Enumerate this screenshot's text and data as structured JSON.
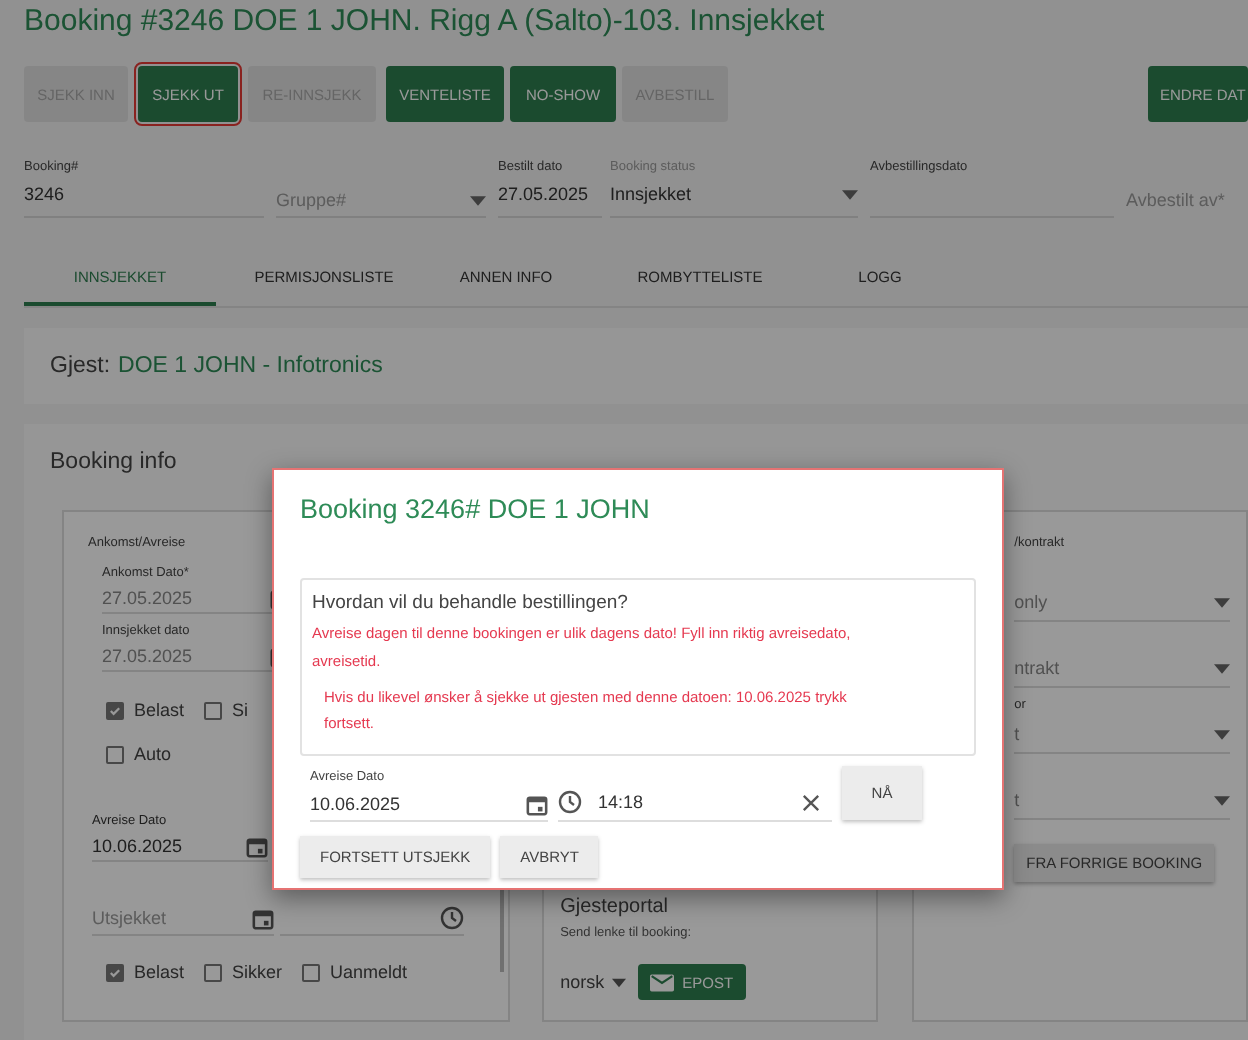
{
  "title": "Booking #3246 DOE 1 JOHN. Rigg A (Salto)-103. Innsjekket",
  "actions": [
    {
      "label": "SJEKK INN",
      "disabled": true,
      "focused": false
    },
    {
      "label": "SJEKK UT",
      "disabled": false,
      "focused": true
    },
    {
      "label": "RE-INNSJEKK",
      "disabled": true,
      "focused": false
    },
    {
      "label": "VENTELISTE",
      "disabled": false,
      "focused": false
    },
    {
      "label": "NO-SHOW",
      "disabled": false,
      "focused": false
    },
    {
      "label": "AVBESTILL",
      "disabled": true,
      "focused": false
    }
  ],
  "end_action": {
    "label": "ENDRE DAT"
  },
  "fields": [
    {
      "kind": "text",
      "label": "Booking#",
      "value": "3246"
    },
    {
      "kind": "select",
      "placeholder": "Gruppe#"
    },
    {
      "kind": "text",
      "label": "Bestilt dato",
      "value": "27.05.2025"
    },
    {
      "kind": "select",
      "label": "Booking status",
      "value": "Innsjekket"
    },
    {
      "kind": "text",
      "label": "Avbestillingsdato"
    },
    {
      "kind": "text",
      "placeholder": "Avbestilt av*"
    }
  ],
  "tabs": [
    {
      "label": "INNSJEKKET",
      "selected": true
    },
    {
      "label": "PERMISJONSLISTE",
      "selected": false
    },
    {
      "label": "ANNEN INFO",
      "selected": false
    },
    {
      "label": "ROMBYTTELISTE",
      "selected": false
    },
    {
      "label": "LOGG",
      "selected": false
    }
  ],
  "guest": {
    "label": "Gjest:",
    "name": "DOE 1 JOHN - Infotronics"
  },
  "booking_info": {
    "title": "Booking info",
    "arrival": {
      "heading": "Ankomst/Avreise",
      "dates": [
        {
          "label": "Ankomst Dato*",
          "value": "27.05.2025"
        },
        {
          "label": "Innsjekket dato",
          "value": "27.05.2025"
        }
      ],
      "checks": [
        {
          "label": "Belast",
          "checked": true
        },
        {
          "label": "Si",
          "checked": false
        }
      ],
      "checks_b": [
        {
          "label": "Auto",
          "checked": false
        }
      ],
      "departure": {
        "label": "Avreise Dato",
        "value": "10.06.2025"
      },
      "checkout": {
        "placeholder": "Utsjekket"
      },
      "checks_c": [
        {
          "label": "Belast",
          "checked": true
        },
        {
          "label": "Sikker",
          "checked": false
        },
        {
          "label": "Uanmeldt",
          "checked": false
        }
      ]
    },
    "portal": {
      "title": "Gjesteportal",
      "hint": "Send lenke til booking:",
      "language": "norsk",
      "button": "EPOST"
    },
    "contract": {
      "heading": "/kontrakt",
      "selects": [
        {
          "value": "only"
        },
        {
          "value": "ntrakt"
        },
        {
          "label": "or",
          "value": "t"
        },
        {
          "value": "t"
        }
      ],
      "button": "FRA FORRIGE BOOKING"
    }
  },
  "dialog": {
    "title": "Booking 3246# DOE 1 JOHN",
    "question": "Hvordan vil du behandle bestillingen?",
    "warning": "Avreise dagen til denne bookingen er ulik dagens dato! Fyll inn riktig avreisedato, avreisetid.",
    "note": "Hvis du likevel ønsker å sjekke ut gjesten med denne datoen: 10.06.2025 trykk fortsett.",
    "date": {
      "label": "Avreise Dato",
      "value": "10.06.2025"
    },
    "time": {
      "value": "14:18"
    },
    "now_button": "NÅ",
    "buttons": [
      "FORTSETT UTSJEKK",
      "AVBRYT"
    ]
  }
}
